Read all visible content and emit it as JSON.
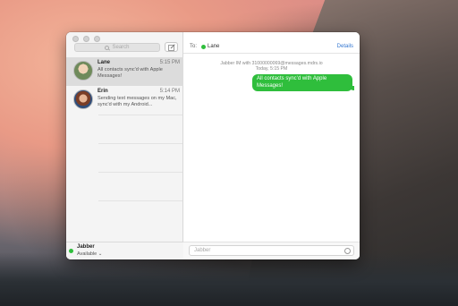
{
  "search": {
    "placeholder": "Search"
  },
  "conversations": [
    {
      "name": "Lane",
      "time": "5:15 PM",
      "preview": "All contacts sync'd with Apple Messages!"
    },
    {
      "name": "Erin",
      "time": "5:14 PM",
      "preview": "Sending text messages on my Mac, sync'd with my Android..."
    }
  ],
  "account": {
    "name": "Jabber",
    "status": "Available ⌄"
  },
  "thread": {
    "to_label": "To:",
    "recipient": "Lane",
    "details_label": "Details",
    "service_line": "Jabber IM with 31000000069@messages.mdrs.io",
    "timestamp": "Today, 5:15 PM",
    "message": "All contacts sync'd with Apple Messages!"
  },
  "composer": {
    "placeholder": "Jabber"
  },
  "colors": {
    "imessage_green": "#2fbe3c",
    "link_blue": "#3477d1",
    "available": "#2fbe3c"
  },
  "icons": [
    "search-icon",
    "compose-icon",
    "emoji-icon"
  ]
}
